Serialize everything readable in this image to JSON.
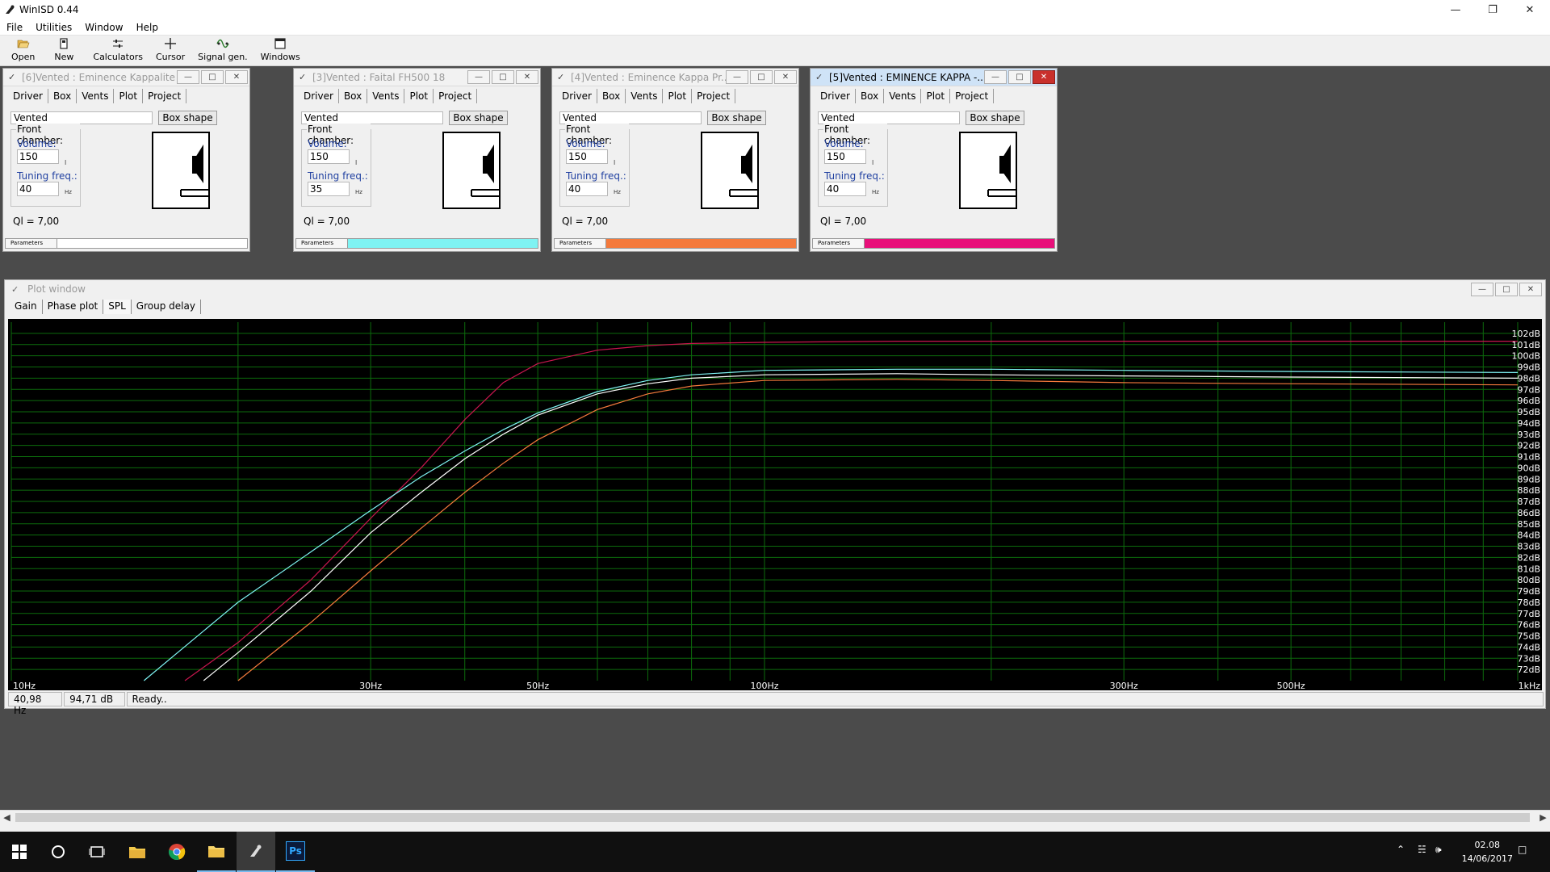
{
  "app": {
    "title": "WinISD 0.44",
    "menu": [
      "File",
      "Utilities",
      "Window",
      "Help"
    ],
    "toolbar": [
      {
        "label": "Open",
        "icon": "folder-open-icon"
      },
      {
        "label": "New",
        "icon": "new-document-icon"
      },
      {
        "label": "Calculators",
        "icon": "calculator-sliders-icon"
      },
      {
        "label": "Cursor",
        "icon": "crosshair-cursor-icon"
      },
      {
        "label": "Signal gen.",
        "icon": "signal-generator-icon"
      },
      {
        "label": "Windows",
        "icon": "windows-icon"
      }
    ]
  },
  "project_windows": [
    {
      "title": "[6]Vented : Eminence Kappalite ...",
      "active": false,
      "tabs": [
        "Driver",
        "Box",
        "Vents",
        "Plot",
        "Project"
      ],
      "selected_tab": "Box",
      "box_type": "Vented",
      "box_shape_label": "Box shape",
      "front_chamber_label": "Front chamber:",
      "volume_label": "Volume:",
      "volume": "150",
      "volume_unit": "l",
      "tuning_label": "Tuning freq.:",
      "tuning": "40",
      "tuning_unit": "Hz",
      "ql": "Ql = 7,00",
      "parameters_label": "Parameters",
      "color": "#ffffff"
    },
    {
      "title": "[3]Vented : Faital FH500 18",
      "active": false,
      "tabs": [
        "Driver",
        "Box",
        "Vents",
        "Plot",
        "Project"
      ],
      "selected_tab": "Box",
      "box_type": "Vented",
      "box_shape_label": "Box shape",
      "front_chamber_label": "Front chamber:",
      "volume_label": "Volume:",
      "volume": "150",
      "volume_unit": "l",
      "tuning_label": "Tuning freq.:",
      "tuning": "35",
      "tuning_unit": "Hz",
      "ql": "Ql = 7,00",
      "parameters_label": "Parameters",
      "color": "#7ff3f3"
    },
    {
      "title": "[4]Vented : Eminence Kappa Pr...",
      "active": false,
      "tabs": [
        "Driver",
        "Box",
        "Vents",
        "Plot",
        "Project"
      ],
      "selected_tab": "Box",
      "box_type": "Vented",
      "box_shape_label": "Box shape",
      "front_chamber_label": "Front chamber:",
      "volume_label": "Volume:",
      "volume": "150",
      "volume_unit": "l",
      "tuning_label": "Tuning freq.:",
      "tuning": "40",
      "tuning_unit": "Hz",
      "ql": "Ql = 7,00",
      "parameters_label": "Parameters",
      "color": "#f47a3c"
    },
    {
      "title": "[5]Vented : EMINENCE KAPPA -...",
      "active": true,
      "tabs": [
        "Driver",
        "Box",
        "Vents",
        "Plot",
        "Project"
      ],
      "selected_tab": "Box",
      "box_type": "Vented",
      "box_shape_label": "Box shape",
      "front_chamber_label": "Front chamber:",
      "volume_label": "Volume:",
      "volume": "150",
      "volume_unit": "l",
      "tuning_label": "Tuning freq.:",
      "tuning": "40",
      "tuning_unit": "Hz",
      "ql": "Ql = 7,00",
      "parameters_label": "Parameters",
      "color": "#e8107a"
    }
  ],
  "plot_window": {
    "title": "Plot window",
    "tabs": [
      "Gain",
      "Phase plot",
      "SPL",
      "Group delay"
    ],
    "selected_tab": "SPL",
    "status": {
      "freq": "40,98 Hz",
      "level": "94,71 dB",
      "message": "Ready.."
    }
  },
  "chart_data": {
    "type": "line",
    "xscale": "log",
    "xlim": [
      10,
      1000
    ],
    "ylim": [
      71,
      103
    ],
    "x_tick_labels": [
      {
        "x": 10,
        "label": "10Hz"
      },
      {
        "x": 30,
        "label": "30Hz"
      },
      {
        "x": 50,
        "label": "50Hz"
      },
      {
        "x": 100,
        "label": "100Hz"
      },
      {
        "x": 300,
        "label": "300Hz"
      },
      {
        "x": 500,
        "label": "500Hz"
      },
      {
        "x": 1000,
        "label": "1kHz"
      }
    ],
    "x_grid": [
      10,
      20,
      30,
      40,
      50,
      60,
      70,
      80,
      90,
      100,
      200,
      300,
      400,
      500,
      600,
      700,
      800,
      900,
      1000
    ],
    "y_ticks": [
      72,
      73,
      74,
      75,
      76,
      77,
      78,
      79,
      80,
      81,
      82,
      83,
      84,
      85,
      86,
      87,
      88,
      89,
      90,
      91,
      92,
      93,
      94,
      95,
      96,
      97,
      98,
      99,
      100,
      101,
      102
    ],
    "y_tick_suffix": "dB",
    "grid": true,
    "background": "#000000",
    "grid_color": "#0c6b0c",
    "series": [
      {
        "color": "#c8164e",
        "x": [
          17,
          20,
          25,
          30,
          35,
          40,
          45,
          50,
          60,
          70,
          80,
          100,
          150,
          200,
          300,
          500,
          1000
        ],
        "y": [
          71,
          74.4,
          80,
          85.5,
          90,
          94.3,
          97.6,
          99.3,
          100.5,
          100.9,
          101.1,
          101.2,
          101.3,
          101.3,
          101.3,
          101.3,
          101.3
        ]
      },
      {
        "color": "#ffffff",
        "x": [
          18,
          20,
          25,
          30,
          35,
          40,
          45,
          50,
          60,
          70,
          80,
          100,
          150,
          200,
          300,
          500,
          1000
        ],
        "y": [
          71,
          73.5,
          79,
          84.2,
          87.8,
          90.8,
          93.0,
          94.7,
          96.6,
          97.5,
          98.0,
          98.3,
          98.4,
          98.3,
          98.2,
          98.1,
          98.0
        ]
      },
      {
        "color": "#7ff3f3",
        "x": [
          15,
          20,
          25,
          30,
          35,
          40,
          45,
          50,
          60,
          70,
          80,
          100,
          150,
          200,
          300,
          500,
          1000
        ],
        "y": [
          71,
          78.0,
          82.5,
          86.2,
          89.2,
          91.5,
          93.4,
          94.9,
          96.8,
          97.8,
          98.3,
          98.7,
          98.8,
          98.8,
          98.7,
          98.6,
          98.5
        ]
      },
      {
        "color": "#f47a3c",
        "x": [
          20,
          25,
          30,
          35,
          40,
          45,
          50,
          60,
          70,
          80,
          100,
          150,
          200,
          300,
          500,
          1000
        ],
        "y": [
          71,
          76.2,
          80.8,
          84.6,
          87.8,
          90.4,
          92.5,
          95.2,
          96.6,
          97.3,
          97.8,
          97.9,
          97.8,
          97.6,
          97.5,
          97.4
        ]
      }
    ]
  },
  "taskbar": {
    "items": [
      {
        "name": "start-button",
        "icon": "windows-logo-icon"
      },
      {
        "name": "search-button",
        "icon": "search-circle-icon"
      },
      {
        "name": "task-view-button",
        "icon": "task-view-icon"
      },
      {
        "name": "file-explorer-app",
        "icon": "folder-icon"
      },
      {
        "name": "chrome-app",
        "icon": "chrome-icon"
      },
      {
        "name": "file-manager-app",
        "icon": "folder-yellow-icon"
      },
      {
        "name": "winisd-app",
        "icon": "winisd-icon"
      },
      {
        "name": "photoshop-app",
        "icon": "photoshop-icon",
        "label": "Ps"
      }
    ],
    "time": "02.08",
    "date": "14/06/2017"
  }
}
